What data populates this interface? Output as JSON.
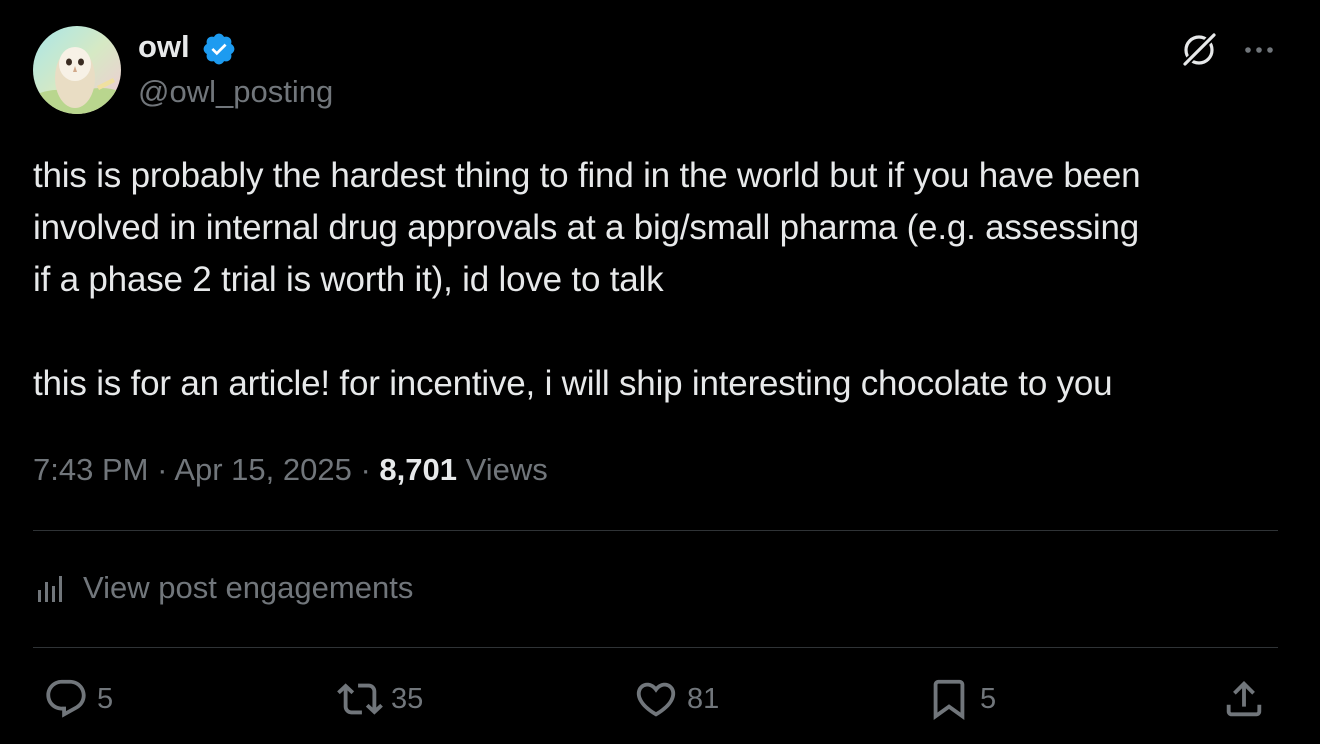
{
  "author": {
    "display_name": "owl",
    "handle": "@owl_posting",
    "verified": true
  },
  "post": {
    "text": "this is probably the hardest thing to find in the world but if you have been\ninvolved in internal drug approvals at a big/small pharma (e.g. assessing\nif a phase 2 trial is worth it), id love to talk\n\nthis is for an article! for incentive, i will ship interesting chocolate to you",
    "time": "7:43 PM",
    "separator": "·",
    "date": "Apr 15, 2025",
    "views_count": "8,701",
    "views_label": "Views"
  },
  "engagements": {
    "label": "View post engagements"
  },
  "actions": {
    "replies": "5",
    "reposts": "35",
    "likes": "81",
    "bookmarks": "5"
  },
  "colors": {
    "background": "#000000",
    "text_primary": "#e7e9ea",
    "text_secondary": "#71767b",
    "verified_blue": "#1d9bf0",
    "divider": "#2f3336"
  },
  "icons": {
    "grok": "grok-icon",
    "more": "more-icon",
    "verified": "verified-badge-icon",
    "engagements": "bar-chart-icon",
    "reply": "reply-icon",
    "repost": "repost-icon",
    "like": "heart-icon",
    "bookmark": "bookmark-icon",
    "share": "share-icon"
  }
}
